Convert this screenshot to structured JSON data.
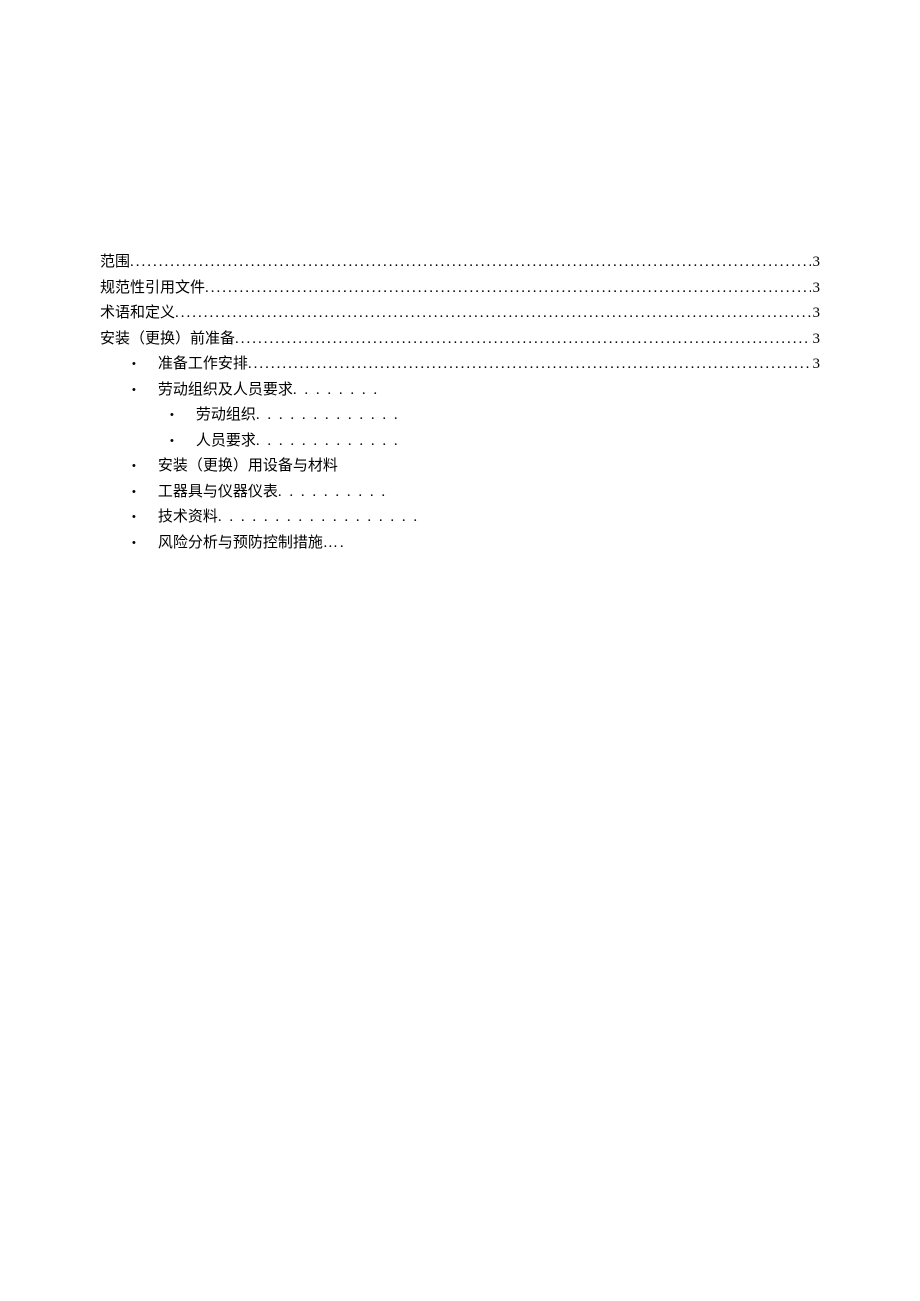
{
  "toc": {
    "items": [
      {
        "label": "范围",
        "page": "3"
      },
      {
        "label": "规范性引用文件",
        "page": "3"
      },
      {
        "label": "术语和定义",
        "page": "3"
      },
      {
        "label": "安装（更换）前准备",
        "page": "3"
      }
    ],
    "sub1": [
      {
        "label": "准备工作安排",
        "page": "3",
        "full": true
      },
      {
        "label": "劳动组织及人员要求",
        "trail": ". . . . . . . ."
      }
    ],
    "sub2": [
      {
        "label": "劳动组织",
        "trail": ". . . . . . . . . . . . ."
      },
      {
        "label": "人员要求",
        "trail": ". . . . . . . . . . . . ."
      }
    ],
    "sub1b": [
      {
        "label": "安装（更换）用设备与材料",
        "trail": ""
      },
      {
        "label": "工器具与仪器仪表",
        "trail": ". . . . . . . . . ."
      },
      {
        "label": "技术资料",
        "trail": ". . . . . . . . . . . . . . . . . ."
      },
      {
        "label": "风险分析与预防控制措施",
        "trail": "…."
      }
    ]
  }
}
